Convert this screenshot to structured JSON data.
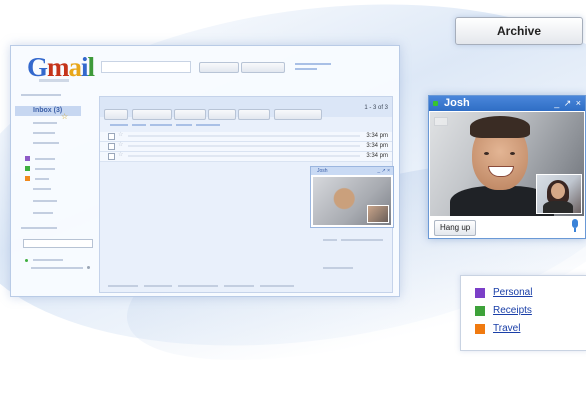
{
  "gmail_window": {
    "logo": "Gmail",
    "logo_colors": {
      "G": "#3368cd",
      "M": "#c5331a",
      "a": "#e8a71b",
      "i": "#3368cd",
      "l": "#3e9a3a"
    },
    "inbox_label": "Inbox (3)",
    "pager": "1 - 3 of 3",
    "rows": [
      {
        "time": "3:34 pm"
      },
      {
        "time": "3:34 pm"
      },
      {
        "time": "3:34 pm"
      }
    ],
    "label_swatch_colors": [
      "#8e5bc7",
      "#3faf3f",
      "#f08a1e"
    ]
  },
  "chat_window": {
    "contact_name": "Josh",
    "window_controls": "_ ↗ ×",
    "status_color": "#37c52e",
    "hangup_label": "Hang up",
    "mic_icon": "microphone-icon"
  },
  "archive_button": {
    "label": "Archive"
  },
  "labels_panel": {
    "items": [
      {
        "label": "Personal",
        "color": "#7b3fc8"
      },
      {
        "label": "Receipts",
        "color": "#3ea23a"
      },
      {
        "label": "Travel",
        "color": "#f07a10"
      }
    ]
  }
}
